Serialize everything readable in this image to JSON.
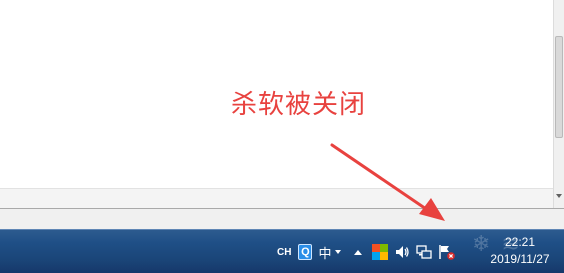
{
  "annotation": {
    "text": "杀软被关闭",
    "color": "#e8423f"
  },
  "taskbar": {
    "tray": {
      "language_indicator": "CH",
      "ime_icon": "Q",
      "ime_mode": "中",
      "ime_menu_icon": "chevron-down-icon",
      "show_hidden_icons": "up-arrow-icon",
      "icons": [
        "windows-flag-icon",
        "speaker-icon",
        "network-icon",
        "action-center-flag-icon"
      ]
    },
    "clock": {
      "time": "22:21",
      "date": "2019/11/27"
    }
  },
  "colors": {
    "taskbar_blue": "#1f4f86",
    "annotation_red": "#e8423f",
    "flag_red": "#f25022",
    "flag_green": "#7fba00",
    "flag_blue": "#00a4ef",
    "flag_yellow": "#ffb900"
  }
}
